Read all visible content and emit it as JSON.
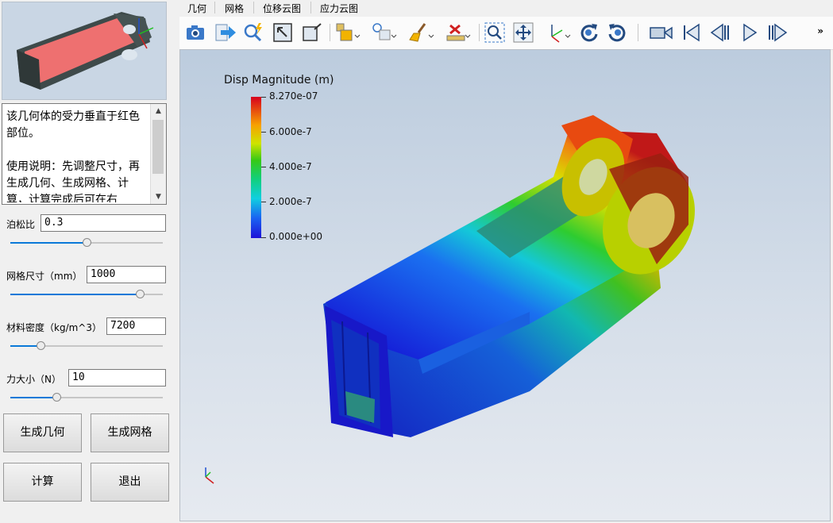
{
  "left_panel": {
    "description": "该几何体的受力垂直于红色部位。\n\n使用说明：先调整尺寸，再生成几何、生成网格、计算，计算完成后可在右",
    "params": [
      {
        "label": "泊松比",
        "value": "0.3",
        "slider": 0.5
      },
      {
        "label": "网格尺寸（mm）",
        "value": "1000",
        "slider": 0.85
      },
      {
        "label": "材料密度（kg/m^3）",
        "value": "7200",
        "slider": 0.2
      },
      {
        "label": "力大小（N）",
        "value": "10",
        "slider": 0.3
      }
    ],
    "buttons": {
      "gen_geometry": "生成几何",
      "gen_mesh": "生成网格",
      "compute": "计算",
      "exit": "退出"
    }
  },
  "menu": [
    "几何",
    "网格",
    "位移云图",
    "应力云图"
  ],
  "toolbar": {
    "icons": [
      "camera-icon",
      "export-icon",
      "render-icon",
      "fit-icon",
      "frame-icon",
      "box-icon",
      "light-icon",
      "brush-icon",
      "ruler-icon",
      "zoom-region-icon",
      "pan-icon",
      "axes-icon",
      "rotate-cw-icon",
      "rotate-ccw-icon",
      "video-icon",
      "first-frame-icon",
      "prev-frame-icon",
      "play-icon",
      "next-frame-icon"
    ],
    "more": "»"
  },
  "viewport": {
    "legend_title": "Disp Magnitude (m)",
    "legend_ticks": [
      "8.270e-07",
      "6.000e-7",
      "4.000e-7",
      "2.000e-7",
      "0.000e+00"
    ],
    "colors": {
      "max": "#d7001e",
      "min": "#1d12d8"
    }
  }
}
